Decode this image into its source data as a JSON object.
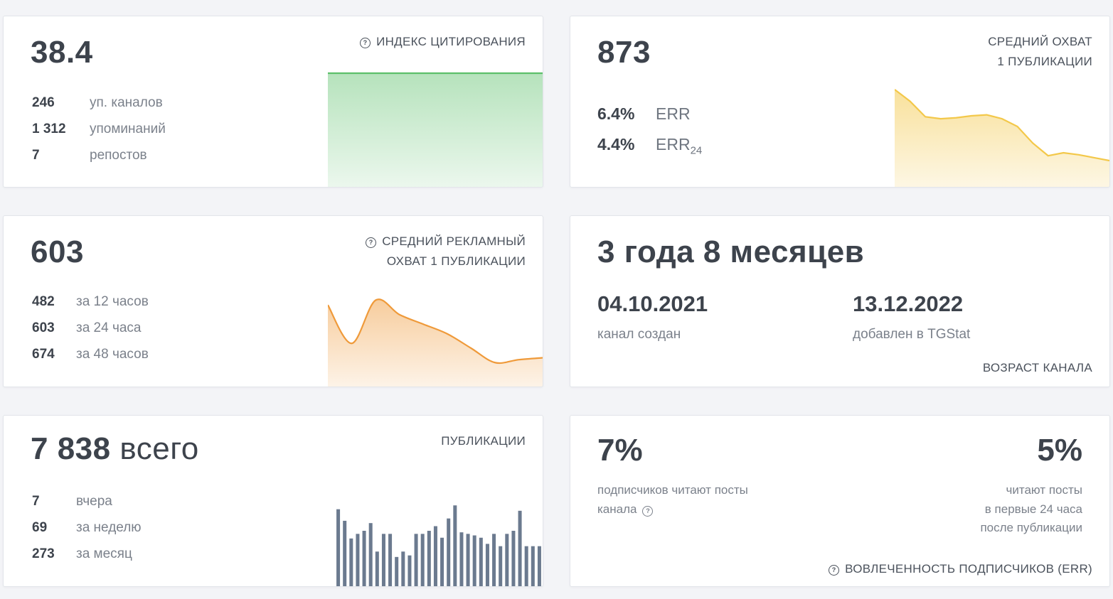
{
  "citation": {
    "value": "38.4",
    "label": "ИНДЕКС ЦИТИРОВАНИЯ",
    "help_icon": "?",
    "rows": [
      {
        "n": "246",
        "t": "уп. каналов"
      },
      {
        "n": "1 312",
        "t": "упоминаний"
      },
      {
        "n": "7",
        "t": "репостов"
      }
    ],
    "color": "#5cc06a"
  },
  "reach": {
    "value": "873",
    "label_line1": "СРЕДНИЙ ОХВАТ",
    "label_line2": "1 ПУБЛИКАЦИИ",
    "err": {
      "n": "6.4%",
      "t": "ERR"
    },
    "err24": {
      "n": "4.4%",
      "t": "ERR",
      "sub": "24"
    },
    "color": "#f3c84a"
  },
  "ad_reach": {
    "value": "603",
    "label_line1": "СРЕДНИЙ РЕКЛАМНЫЙ",
    "label_line2": "ОХВАТ 1 ПУБЛИКАЦИИ",
    "help_icon": "?",
    "rows": [
      {
        "n": "482",
        "t": "за 12 часов"
      },
      {
        "n": "603",
        "t": "за 24 часа"
      },
      {
        "n": "674",
        "t": "за 48 часов"
      }
    ],
    "color": "#ef9a3a"
  },
  "age": {
    "value": "3 года 8 месяцев",
    "created_date": "04.10.2021",
    "created_label": "канал создан",
    "added_date": "13.12.2022",
    "added_label": "добавлен в TGStat",
    "label": "ВОЗРАСТ КАНАЛА"
  },
  "posts": {
    "value": "7 838",
    "value_suffix": "всего",
    "label": "ПУБЛИКАЦИИ",
    "rows": [
      {
        "n": "7",
        "t": "вчера"
      },
      {
        "n": "69",
        "t": "за неделю"
      },
      {
        "n": "273",
        "t": "за месяц"
      }
    ],
    "color": "#6b7a8f"
  },
  "engagement": {
    "left_value": "7%",
    "left_desc_line1": "подписчиков читают посты",
    "left_desc_line2": "канала",
    "right_value": "5%",
    "right_desc_line1": "читают посты",
    "right_desc_line2": "в первые 24 часа",
    "right_desc_line3": "после публикации",
    "label": "ВОВЛЕЧЕННОСТЬ ПОДПИСЧИКОВ (ERR)",
    "help_icon": "?"
  },
  "chart_data": [
    {
      "type": "area",
      "name": "citation-index-sparkline",
      "values": [
        1,
        1
      ]
    },
    {
      "type": "area",
      "name": "average-reach-sparkline",
      "values": [
        100,
        88,
        72,
        70,
        71,
        73,
        74,
        70,
        62,
        45,
        32,
        35,
        33,
        30,
        27
      ]
    },
    {
      "type": "area",
      "name": "ad-reach-sparkline",
      "values": [
        85,
        45,
        90,
        75,
        65,
        55,
        40,
        25,
        28,
        30
      ]
    },
    {
      "type": "bar",
      "name": "publications-sparkline",
      "values": [
        100,
        85,
        62,
        68,
        72,
        82,
        45,
        68,
        68,
        38,
        45,
        40,
        68,
        68,
        72,
        78,
        63,
        88,
        105,
        70,
        68,
        66,
        63,
        55,
        68,
        52,
        68,
        72,
        98,
        52,
        52,
        52
      ]
    }
  ]
}
